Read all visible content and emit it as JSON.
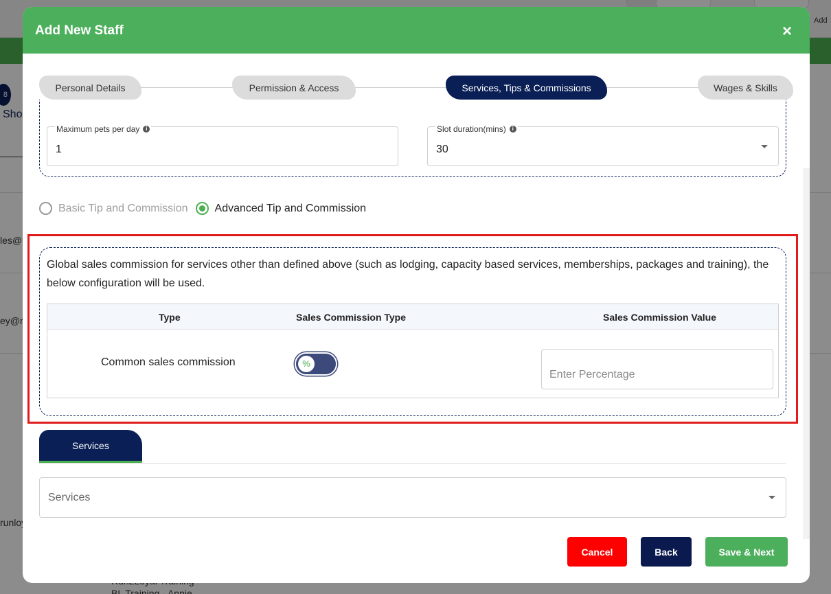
{
  "background": {
    "add_label": "Add",
    "badge_text": "8",
    "partial_texts": [
      "Sho",
      "les@r",
      "ey@ru",
      "runloy",
      "Run2Loyal Training",
      "BL Training - Annie"
    ]
  },
  "modal": {
    "title": "Add New Staff",
    "close_icon": "×"
  },
  "steps": [
    {
      "label": "Personal Details",
      "active": false
    },
    {
      "label": "Permission & Access",
      "active": false
    },
    {
      "label": "Services, Tips & Commissions",
      "active": true
    },
    {
      "label": "Wages & Skills",
      "active": false
    }
  ],
  "scheduling": {
    "max_pets": {
      "label": "Maximum pets per day",
      "value": "1"
    },
    "slot_duration": {
      "label": "Slot duration(mins)",
      "value": "30"
    }
  },
  "tip_mode": {
    "basic_label": "Basic Tip and Commission",
    "advanced_label": "Advanced Tip and Commission",
    "selected": "advanced"
  },
  "commission": {
    "description": "Global sales commission for services other than defined above (such as lodging, capacity based services, memberships, packages and training), the below configuration will be used.",
    "headers": {
      "type": "Type",
      "commission_type": "Sales Commission Type",
      "commission_value": "Sales Commission Value"
    },
    "row": {
      "type": "Common sales commission",
      "toggle_symbol": "%",
      "value_placeholder": "Enter Percentage"
    }
  },
  "services": {
    "tab_label": "Services",
    "select_label": "Services"
  },
  "footer": {
    "cancel": "Cancel",
    "back": "Back",
    "save_next": "Save & Next"
  },
  "colors": {
    "header_green": "#4caf5c",
    "navy": "#0a1f55",
    "cancel_red": "#ff0000",
    "highlight_red": "#e01b1b"
  }
}
